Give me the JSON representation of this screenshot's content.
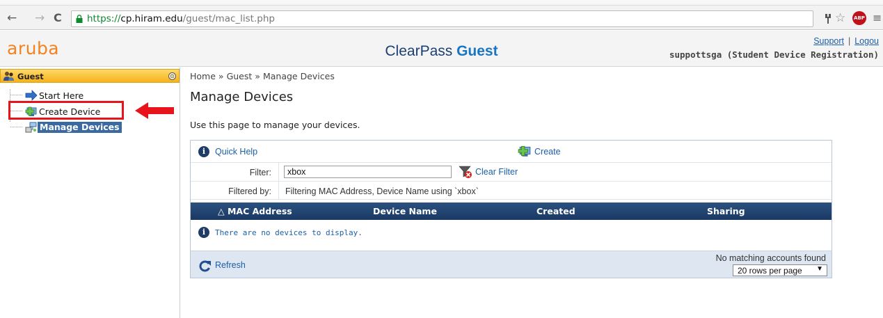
{
  "browser": {
    "back_glyph": "←",
    "forward_glyph": "→",
    "reload_glyph": "C",
    "url_scheme": "https://",
    "url_host": "cp.hiram.edu",
    "url_path": "/guest/mac_list.php",
    "ext_label": "ABP",
    "menu_glyph": "≡",
    "star_glyph": "☆"
  },
  "header": {
    "logo": "aruba",
    "title_a": "ClearPass ",
    "title_b": "Guest",
    "support_link": "Support",
    "sep": "|",
    "logout_link": "Logou",
    "user": "suppottsga (Student Device Registration)"
  },
  "sidebar": {
    "section": "Guest",
    "collapse_glyph": "⊙",
    "items": [
      {
        "label": "Start Here",
        "icon": "arrow-right-icon"
      },
      {
        "label": "Create Device",
        "icon": "add-device-icon"
      },
      {
        "label": "Manage Devices",
        "icon": "network-devices-icon",
        "selected": true
      }
    ]
  },
  "breadcrumb": {
    "items": [
      "Home",
      "Guest",
      "Manage Devices"
    ],
    "sep": "»"
  },
  "page": {
    "title": "Manage Devices",
    "description": "Use this page to manage your devices."
  },
  "panel": {
    "quick_help": "Quick Help",
    "create": "Create",
    "filter_label": "Filter:",
    "filter_value": "xbox",
    "clear_filter": "Clear Filter",
    "filtered_by_label": "Filtered by:",
    "filtered_by_value": "Filtering MAC Address, Device Name using `xbox`",
    "columns": [
      "△ MAC Address",
      "Device Name",
      "Created",
      "Sharing"
    ],
    "empty_message": "There are no devices to display.",
    "refresh": "Refresh",
    "no_match": "No matching accounts found",
    "rows_per_page": "20 rows per page",
    "select_caret": "▼"
  },
  "colors": {
    "aruba_orange": "#f5821f",
    "table_header": "#1f4470",
    "highlight_red": "#e8141c",
    "link_blue": "#1a5fa8"
  }
}
